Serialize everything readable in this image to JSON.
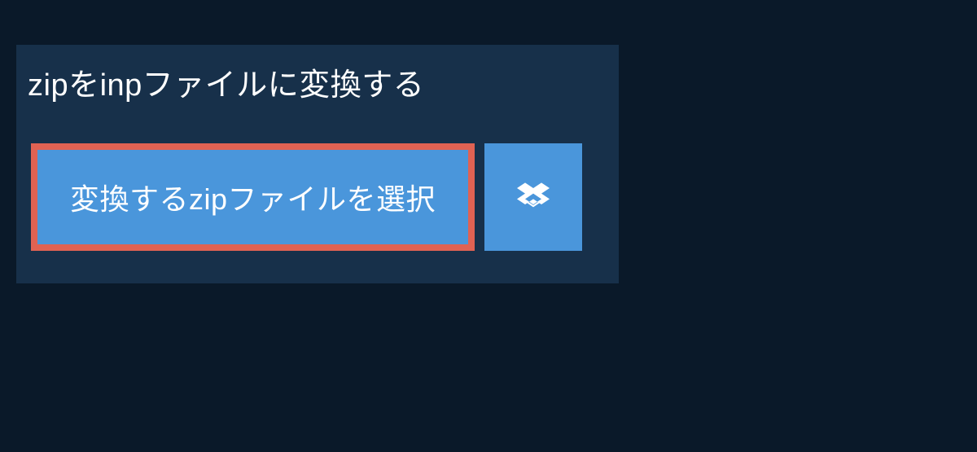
{
  "heading": "zipをinpファイルに変換する",
  "select_button_label": "変換するzipファイルを選択"
}
